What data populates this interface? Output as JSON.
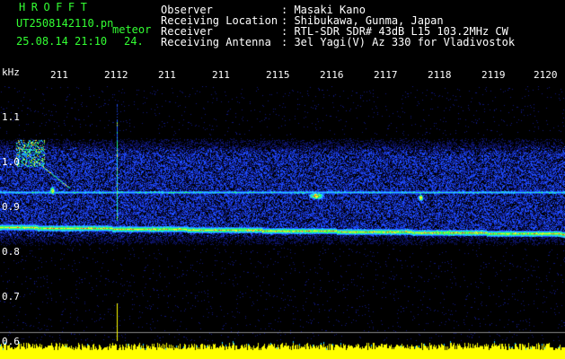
{
  "header": {
    "logo": "HROFFT",
    "filename": "UT2508142110.pn",
    "mode": "meteor",
    "datetime": "25.08.14 21:10",
    "extra": "24.",
    "fields": [
      {
        "label": "Observer",
        "value": ": Masaki Kano"
      },
      {
        "label": "Receiving Location",
        "value": ": Shibukawa, Gunma, Japan"
      },
      {
        "label": "Receiver",
        "value": ": RTL-SDR SDR# 43dB L15 103.2MHz CW"
      },
      {
        "label": "Receiving Antenna",
        "value": ": 3el Yagi(V) Az 330 for Vladivostok"
      }
    ]
  },
  "time_axis": {
    "ticks": [
      "211",
      "2112",
      "211",
      "211",
      "2115",
      "2116",
      "2117",
      "2118",
      "2119",
      "2120"
    ]
  },
  "freq_axis": {
    "unit": "kHz",
    "labels": [
      "1.1",
      "1.0",
      "0.9",
      "0.8",
      "0.7",
      "0.6"
    ]
  },
  "colors": {
    "header_green": "#33ff33",
    "background": "#000000",
    "noise_floor": "#ffff00"
  }
}
